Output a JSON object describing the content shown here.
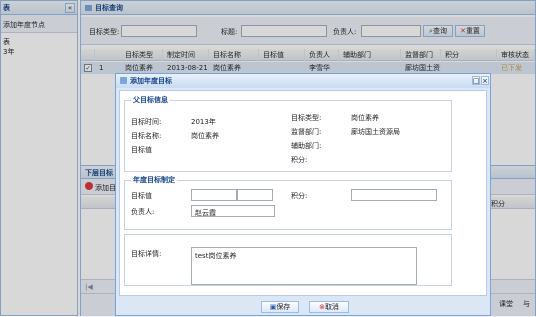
{
  "left_panel": {
    "title": "表",
    "collapse": "«",
    "add_node": "添加年度节点",
    "tree": [
      "表",
      "3年"
    ]
  },
  "search_panel": {
    "title": "目标查询",
    "fields": {
      "type_label": "目标类型:",
      "title_label": "标题:",
      "owner_label": "负责人:"
    },
    "search_btn": "查询",
    "reset_btn": "重置"
  },
  "grid": {
    "columns": [
      "目标类型",
      "制定时间",
      "目标名称",
      "目标值",
      "负责人",
      "辅助部门",
      "监督部门",
      "积分",
      "审核状态"
    ],
    "row": {
      "num": "1",
      "type": "岗位素养",
      "date": "2013-08-21",
      "name": "岗位素养",
      "value": "",
      "owner": "李雪华",
      "assist": "",
      "dept": "廊坊国土资",
      "points": "",
      "status": "已下发"
    }
  },
  "sub_panel": {
    "title": "下层目标",
    "add": "添加目",
    "col_points": "积分"
  },
  "footer_right": {
    "btn1": "课堂",
    "btn2": "与"
  },
  "dialog": {
    "title": "添加年度目标",
    "parent_section": {
      "legend": "父目标信息",
      "time_label": "目标时间:",
      "time_value": "2013年",
      "name_label": "目标名称:",
      "name_value": "岗位素养",
      "value_label": "目标值",
      "type_label": "目标类型:",
      "type_value": "岗位素养",
      "supervise_label": "监督部门:",
      "supervise_value": "廊坊国土资源局",
      "assist_label": "辅助部门:",
      "points_label": "积分:"
    },
    "annual_section": {
      "legend": "年度目标制定",
      "value_label": "目标值",
      "points_label": "积分:",
      "owner_label": "负责人:",
      "owner_value": "赵云霞"
    },
    "detail": {
      "label": "目标详情:",
      "value": "test岗位素养"
    },
    "save_btn": "保存",
    "cancel_btn": "取消"
  }
}
